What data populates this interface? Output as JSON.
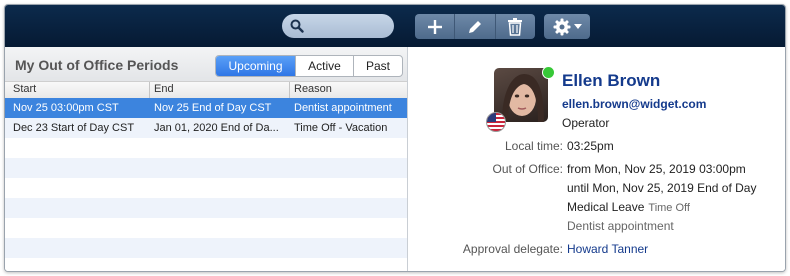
{
  "toolbar": {
    "icons": [
      "search-icon",
      "plus-icon",
      "pencil-icon",
      "trash-icon",
      "gear-icon",
      "chevron-down-icon"
    ]
  },
  "left_panel": {
    "title": "My Out of Office Periods",
    "filters": [
      {
        "label": "Upcoming",
        "selected": true
      },
      {
        "label": "Active",
        "selected": false
      },
      {
        "label": "Past",
        "selected": false
      }
    ],
    "columns": [
      "Start",
      "End",
      "Reason"
    ],
    "rows": [
      {
        "start": "Nov 25 03:00pm CST",
        "end": "Nov 25 End of Day CST",
        "reason": "Dentist appointment",
        "selected": true
      },
      {
        "start": "Dec 23 Start of Day CST",
        "end": "Jan 01, 2020 End of Da...",
        "reason": "Time Off - Vacation",
        "selected": false
      }
    ]
  },
  "detail": {
    "name": "Ellen Brown",
    "email": "ellen.brown@widget.com",
    "role": "Operator",
    "local_time_label": "Local time:",
    "local_time": "03:25pm",
    "ooo_label": "Out of Office:",
    "ooo_from": "from Mon, Nov 25, 2019 03:00pm",
    "ooo_until": "until Mon, Nov 25, 2019 End of Day",
    "reason": "Medical Leave",
    "reason_type": "Time Off",
    "note": "Dentist appointment",
    "delegate_label": "Approval delegate:",
    "delegate": "Howard Tanner",
    "status_color": "#37c837",
    "accent_color": "#143a8c"
  }
}
